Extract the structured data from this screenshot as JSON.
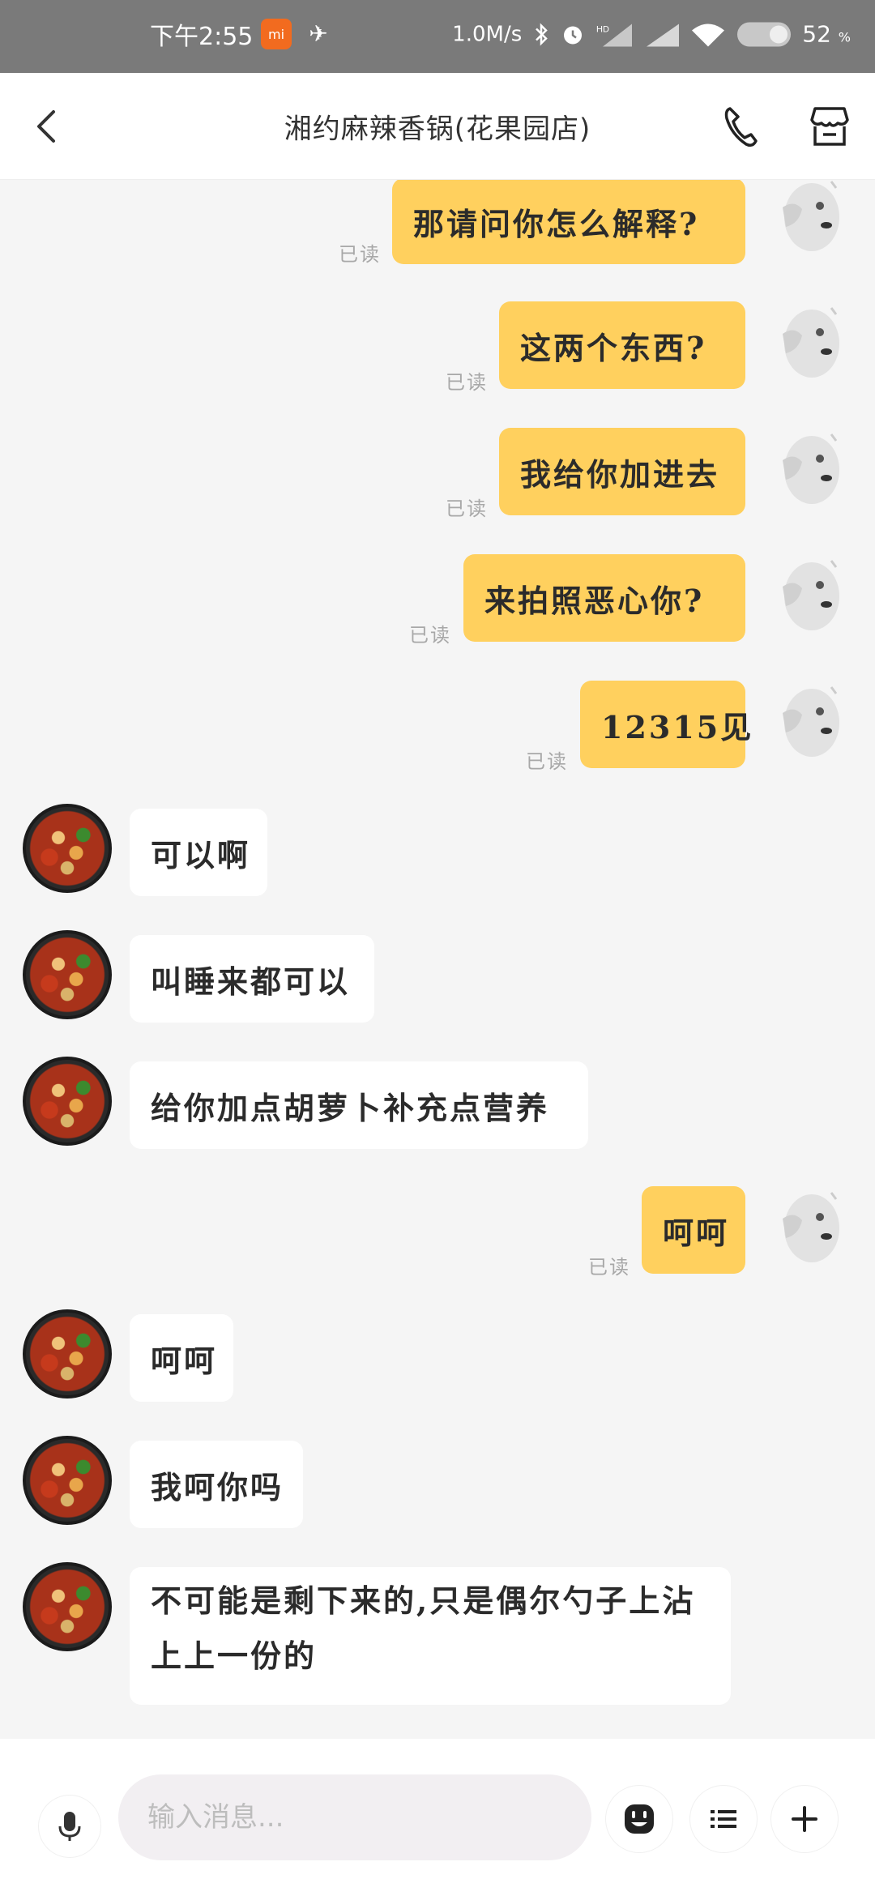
{
  "status_bar": {
    "time": "下午2:55",
    "net_speed": "1.0M/s",
    "battery": "52",
    "battery_unit": "%"
  },
  "header": {
    "title": "湘约麻辣香锅(花果园店)"
  },
  "messages": [
    {
      "side": "out",
      "text": "那请问你怎么解释?",
      "status": "已读"
    },
    {
      "side": "out",
      "text": "这两个东西?",
      "status": "已读"
    },
    {
      "side": "out",
      "text": "我给你加进去",
      "status": "已读"
    },
    {
      "side": "out",
      "text": "来拍照恶心你?",
      "status": "已读"
    },
    {
      "side": "out",
      "text": "12315见",
      "status": "已读"
    },
    {
      "side": "in",
      "text": "可以啊"
    },
    {
      "side": "in",
      "text": "叫睡来都可以"
    },
    {
      "side": "in",
      "text": "给你加点胡萝卜补充点营养"
    },
    {
      "side": "out",
      "text": "呵呵",
      "status": "已读"
    },
    {
      "side": "in",
      "text": "呵呵"
    },
    {
      "side": "in",
      "text": "我呵你吗"
    },
    {
      "side": "in",
      "text": "不可能是剩下来的,只是偶尔勺子上沾上上一份的"
    }
  ],
  "input": {
    "placeholder": "输入消息..."
  },
  "colors": {
    "outgoing_bubble": "#ffd05e",
    "incoming_bubble": "#ffffff",
    "background": "#f5f5f5",
    "status_bar": "#7a7a7a"
  },
  "icons": {
    "back": "chevron-left-icon",
    "phone": "phone-icon",
    "shop": "store-icon",
    "mic": "microphone-icon",
    "emoji": "smiley-icon",
    "list": "list-icon",
    "plus": "plus-icon"
  }
}
